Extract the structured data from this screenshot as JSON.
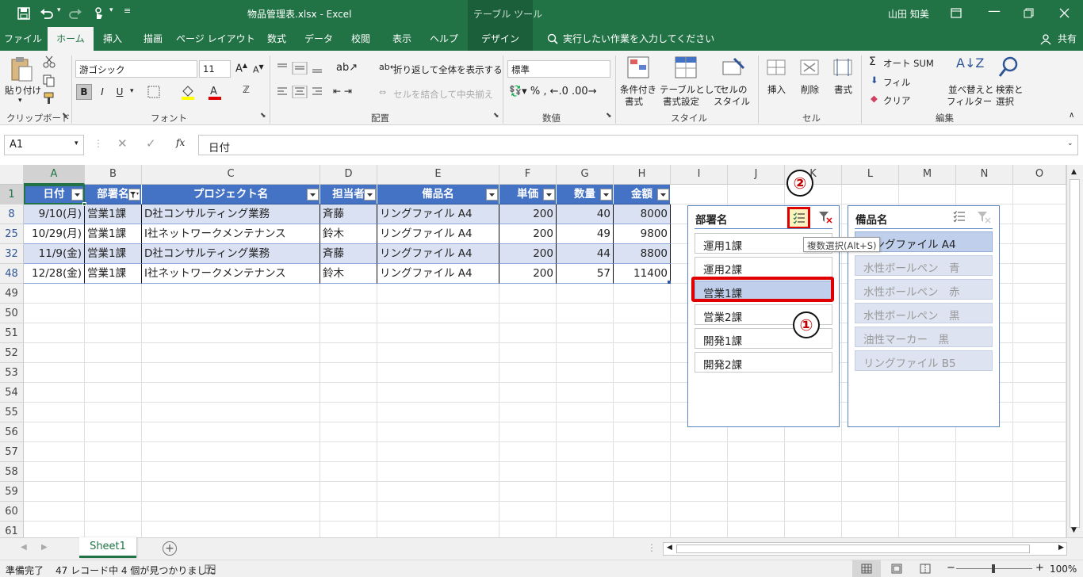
{
  "title": {
    "filename": "物品管理表.xlsx",
    "sep": "-",
    "app": "Excel",
    "context": "テーブル ツール",
    "user": "山田 知美"
  },
  "tabs": [
    "ファイル",
    "ホーム",
    "挿入",
    "描画",
    "ページ レイアウト",
    "数式",
    "データ",
    "校閲",
    "表示",
    "ヘルプ",
    "デザイン"
  ],
  "tell_me": "実行したい作業を入力してください",
  "share": "共有",
  "ribbon": {
    "paste": "貼り付け",
    "clipboard": "クリップボード",
    "font_name": "游ゴシック",
    "font_size": "11",
    "font_group": "フォント",
    "bold": "B",
    "italic": "I",
    "underline": "U",
    "wrap": "折り返して全体を表示する",
    "merge": "セルを結合して中央揃え",
    "align_group": "配置",
    "number_format": "標準",
    "number_group": "数値",
    "cond_format1": "条件付き",
    "cond_format2": "書式",
    "table_format1": "テーブルとして",
    "table_format2": "書式設定",
    "cell_style1": "セルの",
    "cell_style2": "スタイル",
    "style_group": "スタイル",
    "insert": "挿入",
    "delete": "削除",
    "format": "書式",
    "cells_group": "セル",
    "autosum": "オート SUM",
    "fill": "フィル",
    "clear": "クリア",
    "sort1": "並べ替えと",
    "sort2": "フィルター",
    "find1": "検索と",
    "find2": "選択",
    "edit_group": "編集"
  },
  "namebox": "A1",
  "fx": "fx",
  "formula": "日付",
  "columns": [
    "A",
    "B",
    "C",
    "D",
    "E",
    "F",
    "G",
    "H",
    "I",
    "J",
    "K",
    "L",
    "M",
    "N",
    "O"
  ],
  "table_headers": [
    "日付",
    "部署名",
    "プロジェクト名",
    "担当者",
    "備品名",
    "単価",
    "数量",
    "金額"
  ],
  "rows": [
    {
      "num": "8",
      "cells": [
        "9/10(月)",
        "営業1課",
        "D社コンサルティング業務",
        "斉藤",
        "リングファイル A4",
        "200",
        "40",
        "8000"
      ]
    },
    {
      "num": "25",
      "cells": [
        "10/29(月)",
        "営業1課",
        "I社ネットワークメンテナンス",
        "鈴木",
        "リングファイル A4",
        "200",
        "49",
        "9800"
      ]
    },
    {
      "num": "32",
      "cells": [
        "11/9(金)",
        "営業1課",
        "D社コンサルティング業務",
        "斉藤",
        "リングファイル A4",
        "200",
        "44",
        "8800"
      ]
    },
    {
      "num": "48",
      "cells": [
        "12/28(金)",
        "営業1課",
        "I社ネットワークメンテナンス",
        "鈴木",
        "リングファイル A4",
        "200",
        "57",
        "11400"
      ]
    }
  ],
  "empty_rows": [
    "49",
    "50",
    "51",
    "52",
    "53",
    "54",
    "55",
    "56",
    "57",
    "58",
    "59",
    "60",
    "61"
  ],
  "header_row_num": "1",
  "slicer1": {
    "title": "部署名",
    "items": [
      "運用1課",
      "運用2課",
      "営業1課",
      "営業2課",
      "開発1課",
      "開発2課"
    ]
  },
  "slicer2": {
    "title": "備品名",
    "items": [
      "リングファイル A4",
      "水性ボールペン　青",
      "水性ボールペン　赤",
      "水性ボールペン　黒",
      "油性マーカー　黒",
      "リングファイル B5"
    ]
  },
  "tooltip": "複数選択(Alt+S)",
  "callout1": "①",
  "callout2": "②",
  "sheet_tab": "Sheet1",
  "status": {
    "ready": "準備完了",
    "count": "47 レコード中 4 個が見つかりました",
    "zoom": "100%"
  },
  "colors": {
    "excel_green": "#217346",
    "table_header": "#4472c4",
    "band": "#d9e1f2",
    "highlight": "#e00000"
  }
}
